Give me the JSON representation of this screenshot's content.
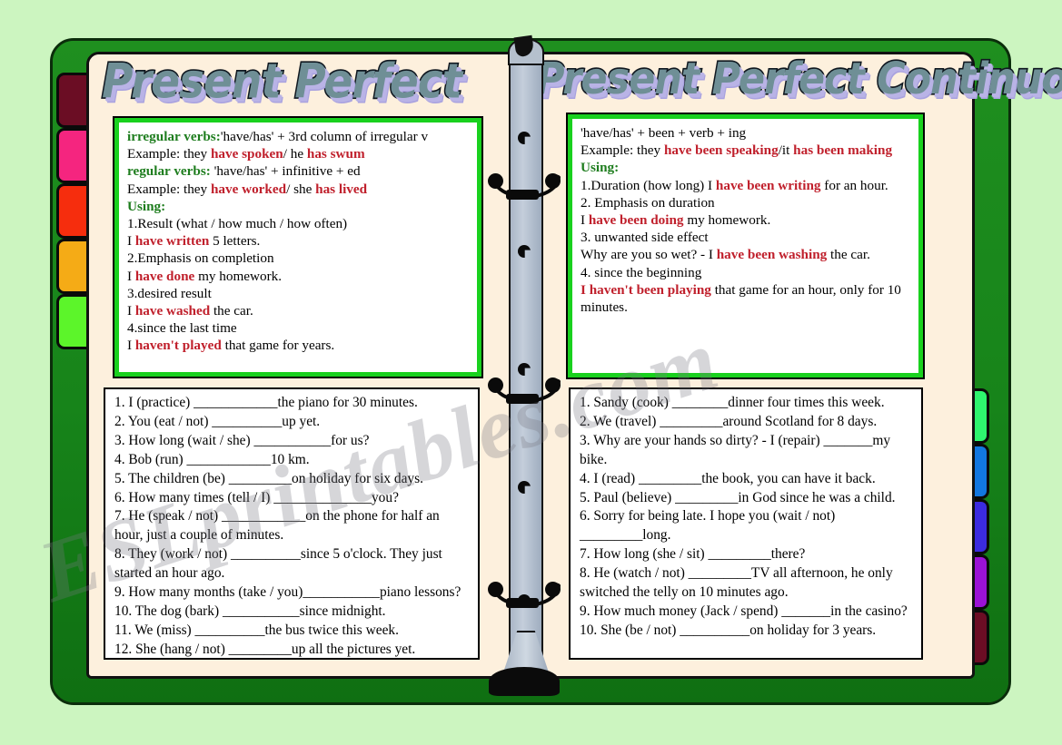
{
  "worksheet": {
    "background_color": "#ccf5c0",
    "cover_color": "#1a8a1a",
    "page_color": "#fbe9d2",
    "accent_green": "#19d11e",
    "rule_green": "#1e7d1e",
    "rule_red": "#c0202c",
    "watermark": "ESLprintables.com"
  },
  "titles": {
    "left": "Present Perfect",
    "right": "Present Perfect Continuous"
  },
  "tabs": {
    "left": [
      {
        "name": "tab-left-1",
        "color": "#6b0d24"
      },
      {
        "name": "tab-left-2",
        "color": "#f5257f"
      },
      {
        "name": "tab-left-3",
        "color": "#f62d0d"
      },
      {
        "name": "tab-left-4",
        "color": "#f5ab16"
      },
      {
        "name": "tab-left-5",
        "color": "#5cf52a"
      }
    ],
    "right": [
      {
        "name": "tab-right-1",
        "color": "#2ef56e"
      },
      {
        "name": "tab-right-2",
        "color": "#1277e0"
      },
      {
        "name": "tab-right-3",
        "color": "#3b2be0"
      },
      {
        "name": "tab-right-4",
        "color": "#9b12d6"
      },
      {
        "name": "tab-right-5",
        "color": "#6b0d24"
      }
    ]
  },
  "rules_left": {
    "lines": [
      [
        {
          "t": "irregular verbs:",
          "s": "grn"
        },
        {
          "t": "'have/has' + 3rd column of irregular v",
          "s": ""
        }
      ],
      [
        {
          "t": "Example:  they ",
          "s": ""
        },
        {
          "t": "have spoken",
          "s": "red"
        },
        {
          "t": "/ he ",
          "s": ""
        },
        {
          "t": "has swum",
          "s": "red"
        }
      ],
      [
        {
          "t": "regular verbs:",
          "s": "grn"
        },
        {
          "t": "  'have/has' + infinitive + ed",
          "s": ""
        }
      ],
      [
        {
          "t": "Example:  they ",
          "s": ""
        },
        {
          "t": "have worked",
          "s": "red"
        },
        {
          "t": "/ she ",
          "s": ""
        },
        {
          "t": "has lived",
          "s": "red"
        }
      ],
      [
        {
          "t": "Using:",
          "s": "grn"
        }
      ],
      [
        {
          "t": "1.Result (what / how much / how often)",
          "s": ""
        }
      ],
      [
        {
          "t": "I ",
          "s": ""
        },
        {
          "t": "have written",
          "s": "red"
        },
        {
          "t": " 5 letters.",
          "s": ""
        }
      ],
      [
        {
          "t": "2.Emphasis on completion",
          "s": ""
        }
      ],
      [
        {
          "t": "I ",
          "s": ""
        },
        {
          "t": "have done",
          "s": "red"
        },
        {
          "t": " my homework.",
          "s": ""
        }
      ],
      [
        {
          "t": "3.desired result",
          "s": ""
        }
      ],
      [
        {
          "t": "I ",
          "s": ""
        },
        {
          "t": "have washed",
          "s": "red"
        },
        {
          "t": " the car.",
          "s": ""
        }
      ],
      [
        {
          "t": "4.since the last time",
          "s": ""
        }
      ],
      [
        {
          "t": "I ",
          "s": ""
        },
        {
          "t": "haven't played",
          "s": "red"
        },
        {
          "t": " that game for years.",
          "s": ""
        }
      ]
    ]
  },
  "rules_right": {
    "lines": [
      [
        {
          "t": " 'have/has' + been + verb + ing",
          "s": ""
        }
      ],
      [
        {
          "t": "Example: they ",
          "s": ""
        },
        {
          "t": "have been speaking",
          "s": "red"
        },
        {
          "t": "/it ",
          "s": ""
        },
        {
          "t": "has been making",
          "s": "red"
        }
      ],
      [
        {
          "t": "Using:",
          "s": "grn"
        }
      ],
      [
        {
          "t": "1.Duration (how long) I ",
          "s": ""
        },
        {
          "t": "have been writing",
          "s": "red"
        },
        {
          "t": " for an hour.",
          "s": ""
        }
      ],
      [
        {
          "t": "2. Emphasis on duration",
          "s": ""
        }
      ],
      [
        {
          "t": "I ",
          "s": ""
        },
        {
          "t": "have been doing",
          "s": "red"
        },
        {
          "t": " my homework.",
          "s": ""
        }
      ],
      [
        {
          "t": "3. unwanted side effect",
          "s": ""
        }
      ],
      [
        {
          "t": "Why are you so wet? - I ",
          "s": ""
        },
        {
          "t": "have been washing",
          "s": "red"
        },
        {
          "t": " the car.",
          "s": ""
        }
      ],
      [
        {
          "t": "4. since the beginning",
          "s": ""
        }
      ],
      [
        {
          "t": "I haven't been playing",
          "s": "red"
        },
        {
          "t": " that game for an hour, only for 10 minutes.",
          "s": ""
        }
      ]
    ]
  },
  "exercises_left": {
    "items": [
      "1. I (practice) ____________the piano for 30 minutes.",
      "2. You (eat / not) __________up yet.",
      "3. How long (wait / she) ___________for us?",
      "4. Bob (run) ____________10 km.",
      "5. The children (be) _________on holiday for six days.",
      "6. How many times (tell / I) ______________you?",
      "7. He (speak / not) ____________on the phone for half an hour, just a couple of minutes.",
      "8. They (work / not) __________since 5 o'clock. They just started an hour ago.",
      "9. How many months (take / you)___________piano lessons?",
      "10. The dog (bark) ___________since midnight.",
      "11. We (miss) __________the bus twice this week.",
      "12. She (hang / not) _________up all the pictures yet."
    ]
  },
  "exercises_right": {
    "items": [
      "1. Sandy (cook) ________dinner four times this week.",
      "2. We (travel) _________around Scotland for 8 days.",
      "3. Why are your hands so dirty? - I (repair) _______my bike.",
      "4. I (read) _________the book, you can have it back.",
      "5. Paul (believe) _________in God since he was a child.",
      "6. Sorry for being late. I hope you (wait / not) _________long.",
      "7. How long (she / sit) _________there?",
      "8. He (watch / not) _________TV all afternoon, he only switched the telly on 10 minutes ago.",
      "9. How much money (Jack / spend) _______in the casino?",
      "10. She (be / not) __________on holiday for 3 years."
    ]
  },
  "binder": {
    "ring_count": 4,
    "hole_count": 4
  }
}
